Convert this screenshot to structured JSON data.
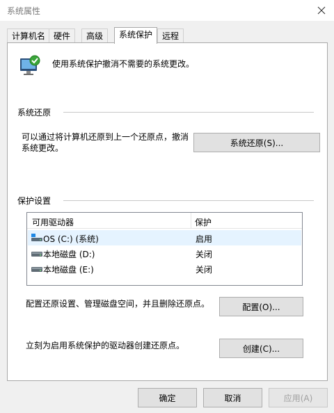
{
  "window": {
    "title": "系统属性",
    "close_icon": "close-icon"
  },
  "tabs": [
    {
      "label": "计算机名",
      "active": false
    },
    {
      "label": "硬件",
      "active": false
    },
    {
      "label": "高级",
      "active": false
    },
    {
      "label": "系统保护",
      "active": true
    },
    {
      "label": "远程",
      "active": false
    }
  ],
  "intro": {
    "text": "使用系统保护撤消不需要的系统更改。",
    "icon": "system-protection-icon"
  },
  "restore": {
    "group_label": "系统还原",
    "description_line1": "可以通过将计算机还原到上一个还原点，撤消",
    "description_line2": "系统更改。",
    "button_label": "系统还原(S)..."
  },
  "protection": {
    "group_label": "保护设置",
    "columns": [
      "可用驱动器",
      "保护"
    ],
    "drives": [
      {
        "name": "OS (C:) (系统)",
        "status": "启用",
        "icon": "system-drive-icon",
        "selected": true
      },
      {
        "name": "本地磁盘 (D:)",
        "status": "关闭",
        "icon": "local-disk-icon",
        "selected": false
      },
      {
        "name": "本地磁盘 (E:)",
        "status": "关闭",
        "icon": "local-disk-icon",
        "selected": false
      }
    ],
    "configure_text": "配置还原设置、管理磁盘空间，并且删除还原点。",
    "configure_button": "配置(O)...",
    "create_text": "立刻为启用系统保护的驱动器创建还原点。",
    "create_button": "创建(C)..."
  },
  "footer": {
    "ok": "确定",
    "cancel": "取消",
    "apply": "应用(A)"
  },
  "colors": {
    "selection": "#e5f3ff",
    "button_face": "#e1e1e1",
    "window_bg": "#f0f0f0"
  }
}
